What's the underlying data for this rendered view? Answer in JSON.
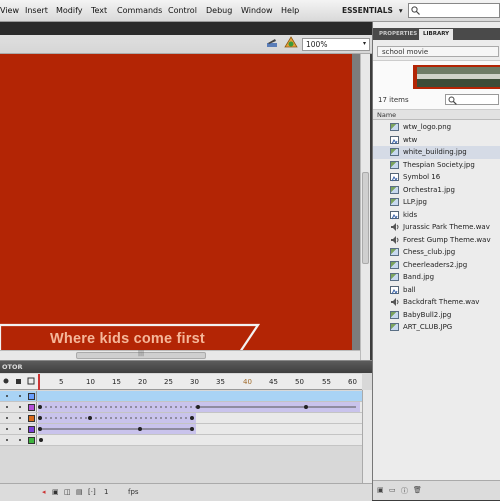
{
  "menu": [
    "View",
    "Insert",
    "Modify",
    "Text",
    "Commands",
    "Control",
    "Debug",
    "Window",
    "Help"
  ],
  "workspace": {
    "label": "ESSENTIALS",
    "chevron": "▾"
  },
  "editbar": {
    "zoom": "100%",
    "zoom_dropdown": "▾"
  },
  "stage": {
    "background": "#b32505",
    "banner_text": "Where kids come first"
  },
  "timeline": {
    "tab_label": "OTOR",
    "frame_numbers": [
      "5",
      "10",
      "15",
      "20",
      "25",
      "30",
      "35",
      "40",
      "45",
      "50",
      "55",
      "60"
    ],
    "layer_colors": [
      "#6aa0ff",
      "#b44fd8",
      "#d86a1a",
      "#7a3fd8",
      "#3fb43f"
    ],
    "fps_label": "fps"
  },
  "panel": {
    "tabs": [
      "PROPERTIES",
      "LIBRARY"
    ],
    "document": "school movie",
    "items_count": "17 items",
    "name_header": "Name",
    "items": [
      {
        "name": "wtw_logo.png",
        "icon": "bitmap-icon"
      },
      {
        "name": "wtw",
        "icon": "symbol-icon"
      },
      {
        "name": "white_building.jpg",
        "icon": "bitmap-icon"
      },
      {
        "name": "Thespian Society.jpg",
        "icon": "bitmap-icon"
      },
      {
        "name": "Symbol 16",
        "icon": "symbol-icon"
      },
      {
        "name": "Orchestra1.jpg",
        "icon": "bitmap-icon"
      },
      {
        "name": "LLP.jpg",
        "icon": "bitmap-icon"
      },
      {
        "name": "kids",
        "icon": "symbol-icon"
      },
      {
        "name": "Jurassic Park Theme.wav",
        "icon": "sound-icon"
      },
      {
        "name": "Forest Gump Theme.wav",
        "icon": "sound-icon"
      },
      {
        "name": "Chess_club.jpg",
        "icon": "bitmap-icon"
      },
      {
        "name": "Cheerleaders2.jpg",
        "icon": "bitmap-icon"
      },
      {
        "name": "Band.jpg",
        "icon": "bitmap-icon"
      },
      {
        "name": "ball",
        "icon": "symbol-icon"
      },
      {
        "name": "Backdraft Theme.wav",
        "icon": "sound-icon"
      },
      {
        "name": "BabyBull2.jpg",
        "icon": "bitmap-icon"
      },
      {
        "name": "ART_CLUB.JPG",
        "icon": "bitmap-icon"
      }
    ]
  }
}
